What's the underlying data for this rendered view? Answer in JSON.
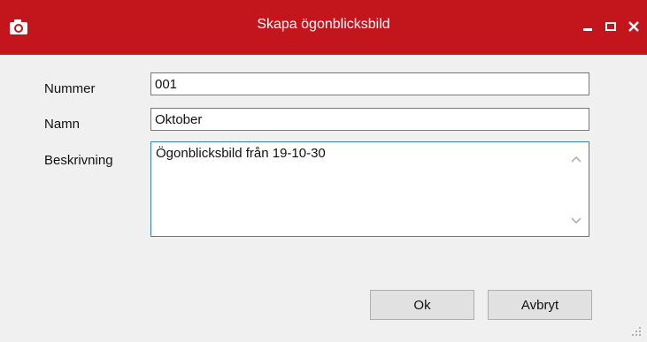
{
  "window": {
    "title": "Skapa ögonblicksbild",
    "icon": "camera-icon",
    "titlebar_color": "#c3161c",
    "controls": [
      "minimize-icon",
      "maximize-icon",
      "close-icon"
    ]
  },
  "form": {
    "number": {
      "label": "Nummer",
      "value": "001"
    },
    "name": {
      "label": "Namn",
      "value": "Oktober"
    },
    "description": {
      "label": "Beskrivning",
      "value": "Ögonblicksbild från 19-10-30"
    }
  },
  "buttons": {
    "ok": "Ok",
    "cancel": "Avbryt"
  }
}
